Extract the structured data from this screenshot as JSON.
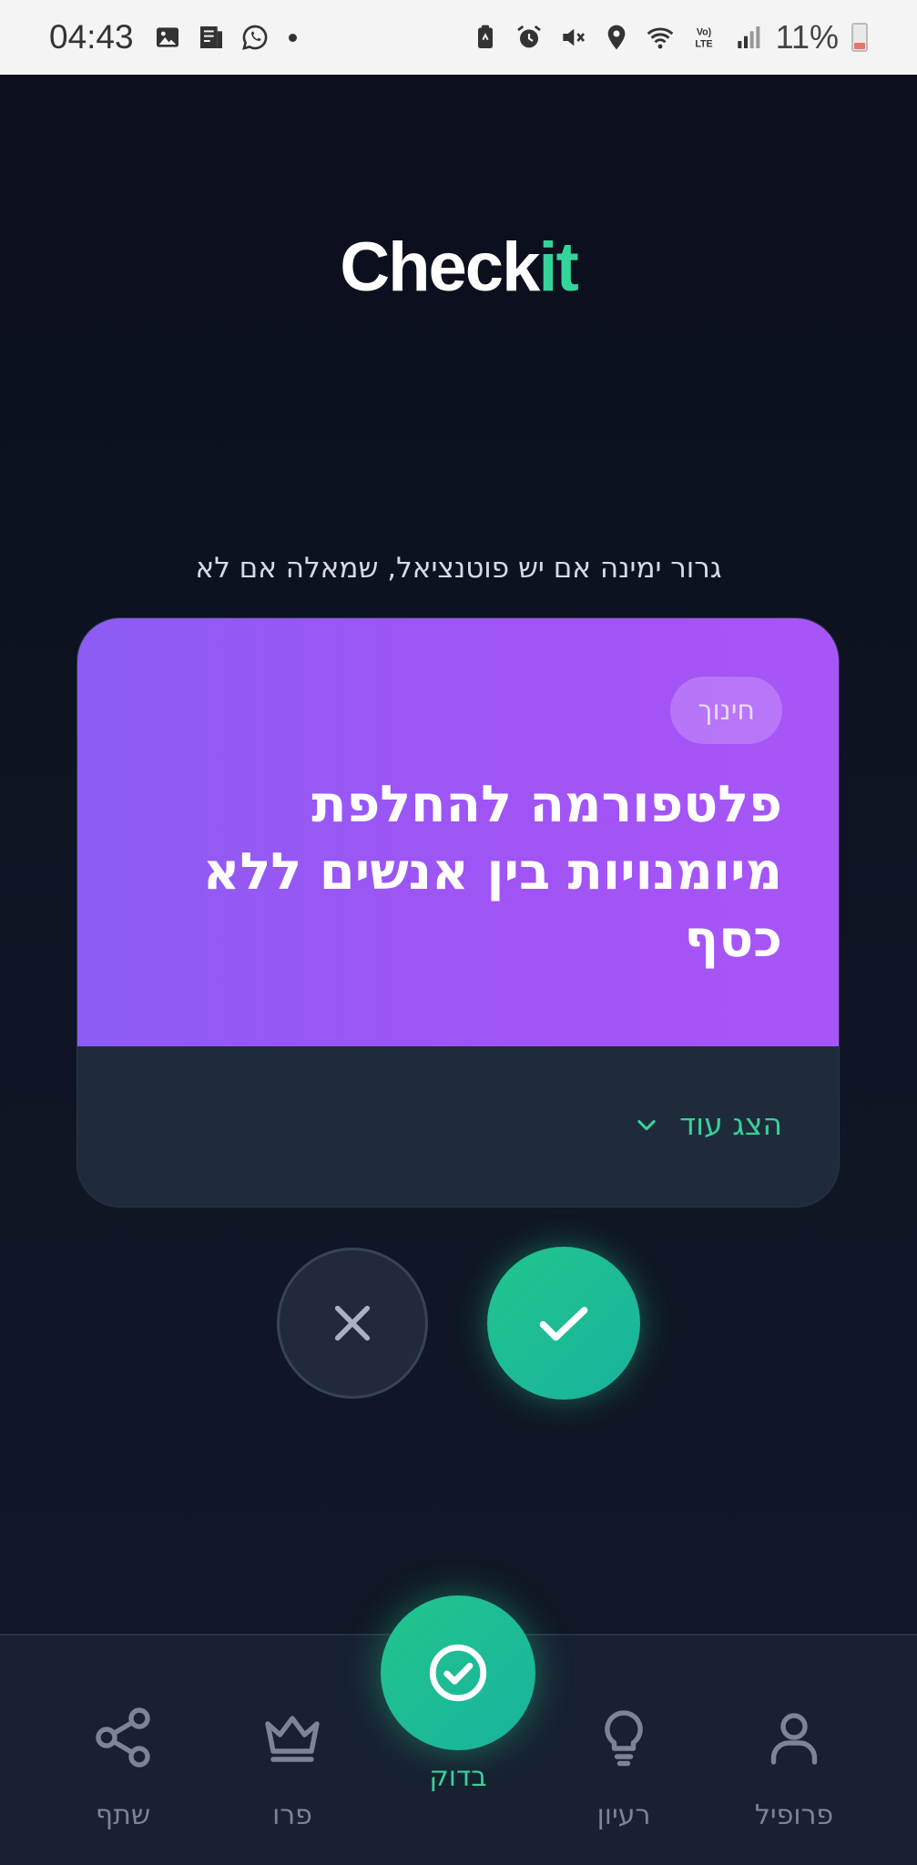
{
  "status_bar": {
    "time": "04:43",
    "left_icons": [
      "image-icon",
      "news-icon",
      "whatsapp-icon",
      "dot-icon"
    ],
    "right_icons": [
      "clipboard-icon",
      "alarm-icon",
      "mute-icon",
      "location-icon",
      "wifi-icon",
      "volte-icon",
      "signal-icon"
    ],
    "battery_percent": "11%"
  },
  "header": {
    "logo_main": "Check",
    "logo_accent": "it",
    "accent_color": "#34d399"
  },
  "instruction": "גרור ימינה אם יש פוטנציאל, שמאלה אם לא",
  "card": {
    "category": "חינוך",
    "title": "פלטפורמה להחלפת מיומנויות בין אנשים ללא כסף",
    "show_more_label": "הצג עוד",
    "gradient_colors": [
      "#8d5cf5",
      "#a855f7"
    ]
  },
  "actions": {
    "reject_icon": "close-icon",
    "accept_icon": "check-icon"
  },
  "bottom_nav": {
    "items": [
      {
        "label": "שתף",
        "icon": "share-icon"
      },
      {
        "label": "פרו",
        "icon": "crown-icon"
      },
      {
        "label": "בדוק",
        "icon": "check-circle-icon",
        "active": true
      },
      {
        "label": "רעיון",
        "icon": "lightbulb-icon"
      },
      {
        "label": "פרופיל",
        "icon": "user-icon"
      }
    ]
  }
}
